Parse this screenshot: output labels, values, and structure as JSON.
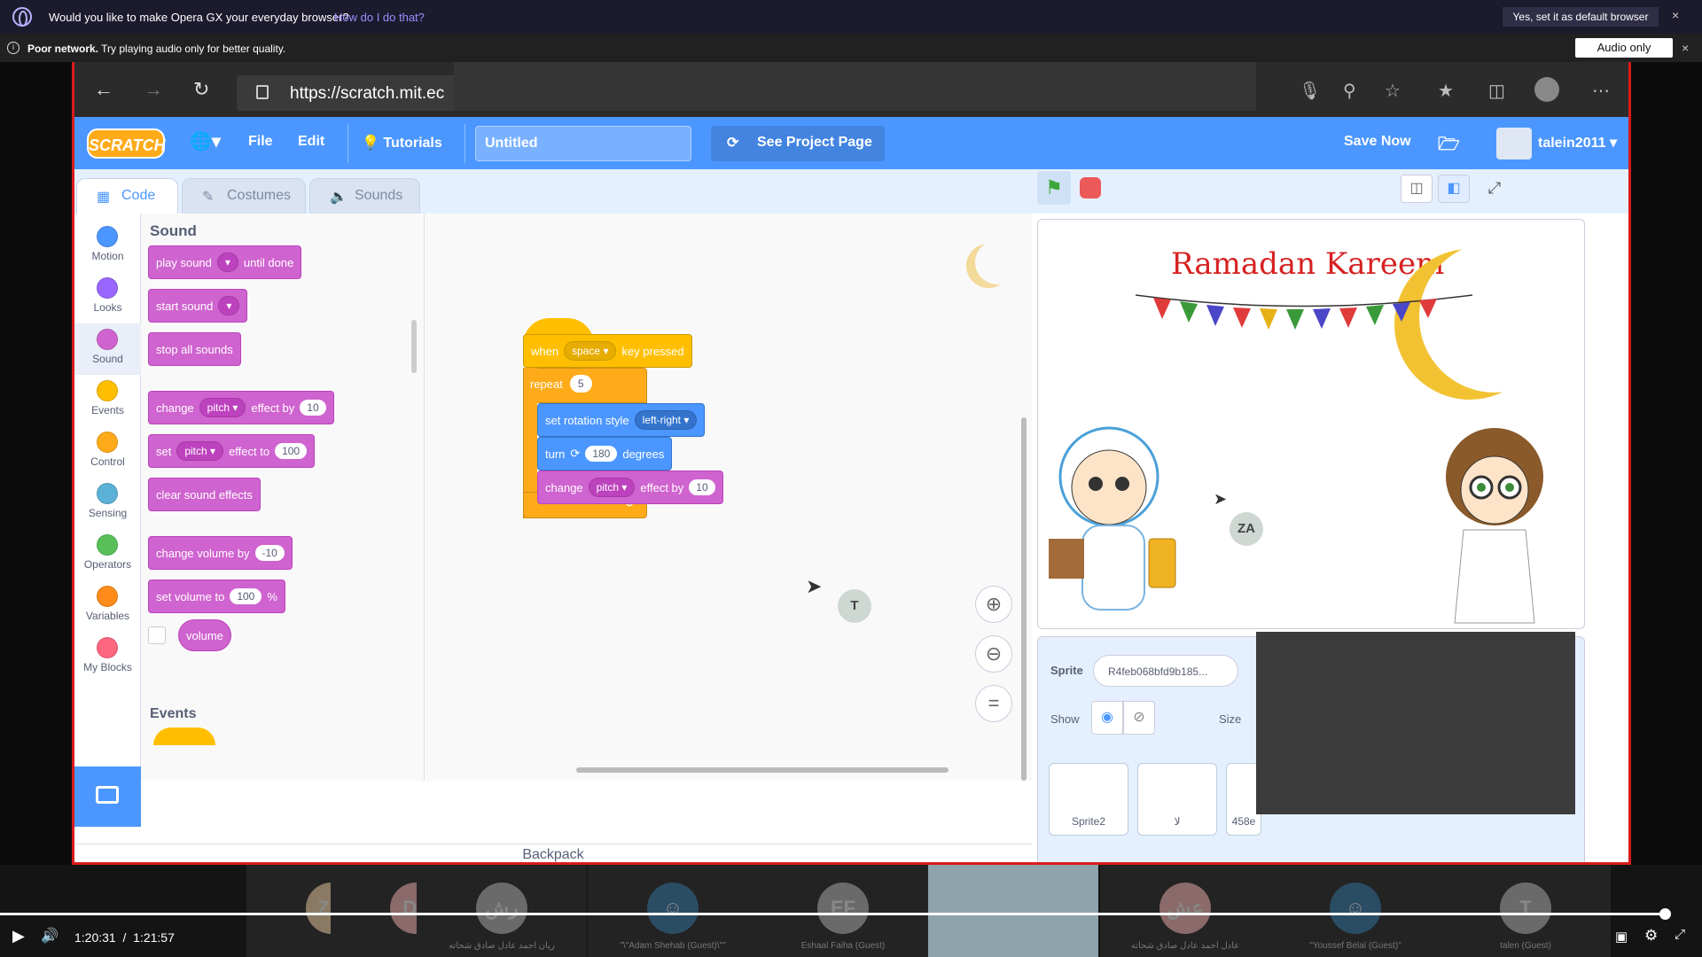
{
  "opera_banner": {
    "message": "Would you like to make Opera GX your everyday browser?",
    "link": "How do I do that?",
    "button": "Yes, set it as default browser",
    "close": "×"
  },
  "network_banner": {
    "title": "Poor network.",
    "message": "Try playing audio only for better quality.",
    "button": "Audio only",
    "close": "×"
  },
  "browser": {
    "url": "https://scratch.mit.ec"
  },
  "scratch_menu": {
    "logo": "SCRATCH",
    "file": "File",
    "edit": "Edit",
    "tutorials": "Tutorials",
    "project_title": "Untitled",
    "see_project": "See Project Page",
    "save_now": "Save Now",
    "username": "talein2011"
  },
  "tabs": {
    "code": "Code",
    "costumes": "Costumes",
    "sounds": "Sounds"
  },
  "categories": [
    {
      "label": "Motion",
      "color": "#4c97ff"
    },
    {
      "label": "Looks",
      "color": "#9966ff"
    },
    {
      "label": "Sound",
      "color": "#cf63cf"
    },
    {
      "label": "Events",
      "color": "#ffbf00"
    },
    {
      "label": "Control",
      "color": "#ffab19"
    },
    {
      "label": "Sensing",
      "color": "#5cb1d6"
    },
    {
      "label": "Operators",
      "color": "#59c059"
    },
    {
      "label": "Variables",
      "color": "#ff8c1a"
    },
    {
      "label": "My Blocks",
      "color": "#ff6680"
    }
  ],
  "palette": {
    "heading": "Sound",
    "play_sound": "play sound",
    "until_done": "until done",
    "start_sound": "start sound",
    "stop_all_sounds": "stop all sounds",
    "change": "change",
    "pitch": "pitch",
    "effect_by": "effect by",
    "change_pitch_value": "10",
    "set": "set",
    "effect_to": "effect to",
    "set_pitch_value": "100",
    "clear_sound_effects": "clear sound effects",
    "change_volume_by": "change volume by",
    "change_volume_value": "-10",
    "set_volume_to": "set volume to",
    "set_volume_value": "100",
    "percent": "%",
    "volume": "volume",
    "events_heading": "Events"
  },
  "script": {
    "when": "when",
    "key": "space",
    "key_pressed": "key pressed",
    "repeat": "repeat",
    "repeat_count": "5",
    "set_rotation_style": "set rotation style",
    "rotation_style": "left-right",
    "turn": "turn",
    "degrees_value": "180",
    "degrees": "degrees",
    "change": "change",
    "effect": "pitch",
    "effect_by": "effect by",
    "effect_value": "10",
    "loop_arrow": "↻"
  },
  "canvas_cursors": {
    "t": "T",
    "za": "ZA"
  },
  "backpack": "Backpack",
  "stage": {
    "title": "Ramadan Kareem"
  },
  "sprite_info": {
    "sprite_label": "Sprite",
    "sprite_name": "R4feb068bfd9b185...",
    "show_label": "Show",
    "size_label": "Size",
    "thumbnails": [
      "Sprite2",
      "لا",
      "458e"
    ]
  },
  "participants": [
    {
      "initials": "ZM",
      "color": "#8a7a64",
      "name": ""
    },
    {
      "initials": "DL",
      "color": "#8a6a6a",
      "name": ""
    },
    {
      "initials": "رش",
      "color": "#6a6a6a",
      "name": "ريان احمد عادل صادق شحاته"
    },
    {
      "initials": "☺",
      "color": "#2a4d64",
      "name": "\"\\\"Adam Shehab (Guest)\\\"\""
    },
    {
      "initials": "EF",
      "color": "#6a6a6a",
      "name": "Eshaal Faiha (Guest)"
    },
    {
      "initials": "",
      "color": "#cfd7e0",
      "name": ""
    },
    {
      "initials": "عش",
      "color": "#8a6a6a",
      "name": "عادل احمد عادل صادق شحاته"
    },
    {
      "initials": "☺",
      "color": "#2a4d64",
      "name": "\"Youssef Belal (Guest)\""
    },
    {
      "initials": "T",
      "color": "#6a6a6a",
      "name": "talen (Guest)"
    }
  ],
  "player": {
    "current": "1:20:31",
    "separator": "/",
    "duration": "1:21:57",
    "progress_fraction": 0.982
  }
}
